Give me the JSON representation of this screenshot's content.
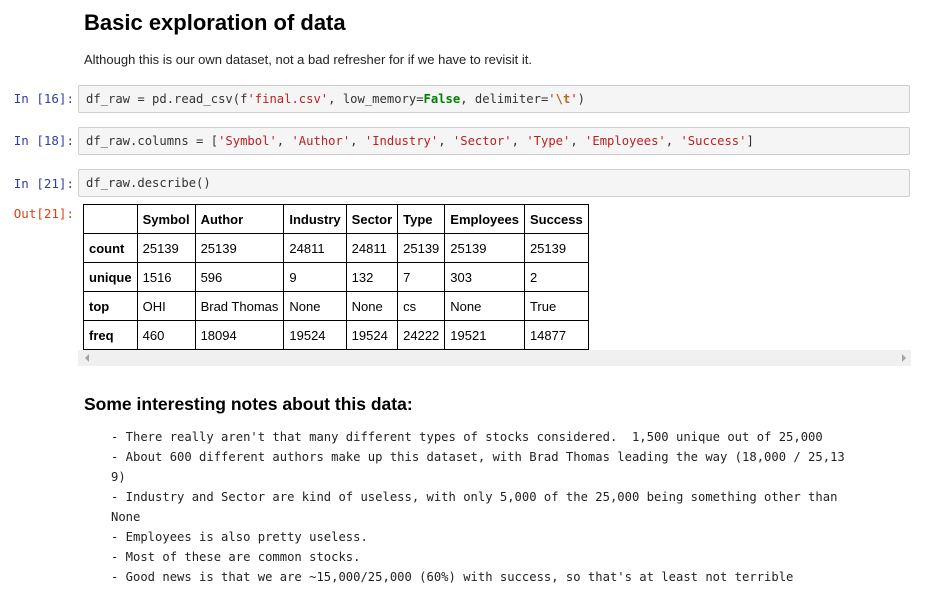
{
  "markdown": {
    "heading": "Basic exploration of data",
    "intro": "Although this is our own dataset, not a bad refresher for if we have to revisit it."
  },
  "cells": [
    {
      "prompt": "In [16]:",
      "code": [
        {
          "t": "plain",
          "v": "df_raw = pd.read_csv(f"
        },
        {
          "t": "str",
          "v": "'final.csv'"
        },
        {
          "t": "plain",
          "v": ", low_memory="
        },
        {
          "t": "kw",
          "v": "False"
        },
        {
          "t": "plain",
          "v": ", delimiter="
        },
        {
          "t": "str",
          "v": "'"
        },
        {
          "t": "esc",
          "v": "\\t"
        },
        {
          "t": "str",
          "v": "'"
        },
        {
          "t": "plain",
          "v": ")"
        }
      ]
    },
    {
      "prompt": "In [18]:",
      "code": [
        {
          "t": "plain",
          "v": "df_raw.columns = ["
        },
        {
          "t": "str",
          "v": "'Symbol'"
        },
        {
          "t": "plain",
          "v": ", "
        },
        {
          "t": "str",
          "v": "'Author'"
        },
        {
          "t": "plain",
          "v": ", "
        },
        {
          "t": "str",
          "v": "'Industry'"
        },
        {
          "t": "plain",
          "v": ", "
        },
        {
          "t": "str",
          "v": "'Sector'"
        },
        {
          "t": "plain",
          "v": ", "
        },
        {
          "t": "str",
          "v": "'Type'"
        },
        {
          "t": "plain",
          "v": ", "
        },
        {
          "t": "str",
          "v": "'Employees'"
        },
        {
          "t": "plain",
          "v": ", "
        },
        {
          "t": "str",
          "v": "'Success'"
        },
        {
          "t": "plain",
          "v": "]"
        }
      ]
    },
    {
      "prompt": "In [21]:",
      "code": [
        {
          "t": "plain",
          "v": "df_raw.describe()"
        }
      ]
    }
  ],
  "output": {
    "prompt": "Out[21]:",
    "table": {
      "columns": [
        "",
        "Symbol",
        "Author",
        "Industry",
        "Sector",
        "Type",
        "Employees",
        "Success"
      ],
      "rows": [
        {
          "index": "count",
          "values": [
            "25139",
            "25139",
            "24811",
            "24811",
            "25139",
            "25139",
            "25139"
          ]
        },
        {
          "index": "unique",
          "values": [
            "1516",
            "596",
            "9",
            "132",
            "7",
            "303",
            "2"
          ]
        },
        {
          "index": "top",
          "values": [
            "OHI",
            "Brad Thomas",
            "None",
            "None",
            "cs",
            "None",
            "True"
          ]
        },
        {
          "index": "freq",
          "values": [
            "460",
            "18094",
            "19524",
            "19524",
            "24222",
            "19521",
            "14877"
          ]
        }
      ]
    }
  },
  "notes": {
    "heading": "Some interesting notes about this data:",
    "lines": [
      "- There really aren't that many different types of stocks considered.  1,500 unique out of 25,000",
      "- About 600 different authors make up this dataset, with Brad Thomas leading the way (18,000 / 25,13\n9)",
      "- Industry and Sector are kind of useless, with only 5,000 of the 25,000 being something other than\nNone",
      "- Employees is also pretty useless.",
      "- Most of these are common stocks.",
      "- Good news is that we are ~15,000/25,000 (60%) with success, so that's at least not terrible"
    ]
  }
}
